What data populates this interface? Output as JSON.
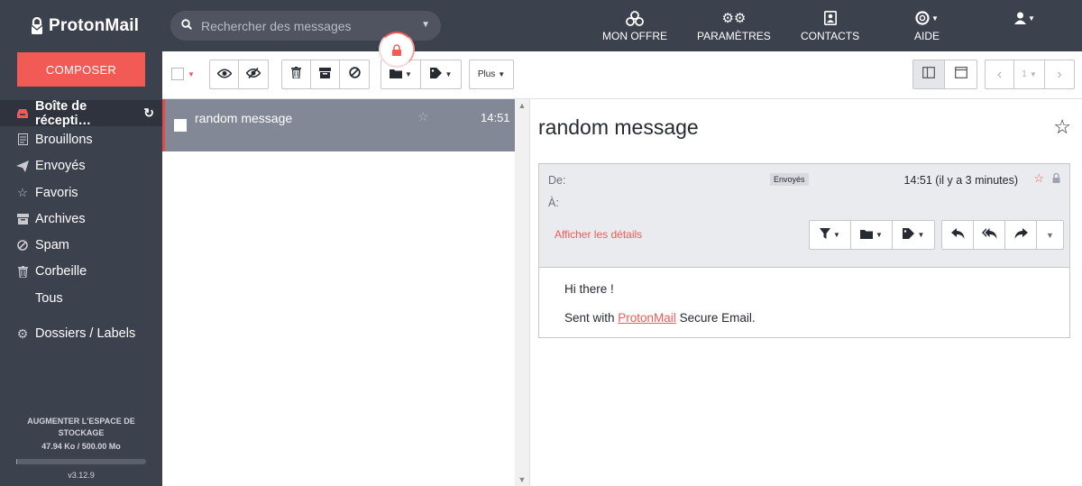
{
  "brand": {
    "name": "ProtonMail"
  },
  "sidebar": {
    "compose_label": "COMPOSER",
    "items": [
      {
        "label": "Boîte de récepti…",
        "icon": "inbox-icon"
      },
      {
        "label": "Brouillons",
        "icon": "file-icon"
      },
      {
        "label": "Envoyés",
        "icon": "paper-plane-icon"
      },
      {
        "label": "Favoris",
        "icon": "star-icon"
      },
      {
        "label": "Archives",
        "icon": "archive-icon"
      },
      {
        "label": "Spam",
        "icon": "ban-icon"
      },
      {
        "label": "Corbeille",
        "icon": "trash-icon"
      },
      {
        "label": "Tous",
        "icon": ""
      },
      {
        "label": "Dossiers / Labels",
        "icon": "gear-icon"
      }
    ],
    "storage_title": "AUGMENTER L'ESPACE DE STOCKAGE",
    "storage_value": "47.94 Ko / 500.00 Mo",
    "storage_used_fraction": 0.0001,
    "version": "v3.12.9"
  },
  "topbar": {
    "search_placeholder": "Rechercher des messages",
    "links": {
      "offer": "MON OFFRE",
      "settings": "PARAMÈTRES",
      "contacts": "CONTACTS",
      "help": "AIDE"
    }
  },
  "toolbar": {
    "more_label": "Plus",
    "page_number": "1"
  },
  "list": {
    "messages": [
      {
        "subject": "random message",
        "time": "14:51"
      }
    ]
  },
  "reader": {
    "title": "random message",
    "from_label": "De:",
    "to_label": "À:",
    "badge": "Envoyés",
    "timestamp": "14:51 (il y a 3 minutes)",
    "details_link": "Afficher les détails",
    "body_line1": "Hi there !",
    "body_prefix": "Sent with ",
    "body_link": "ProtonMail",
    "body_suffix": " Secure Email."
  },
  "colors": {
    "sidebar_bg": "#3c414e",
    "accent": "#f25a55",
    "selected_row": "#828895",
    "header_bg": "#e9ebef"
  }
}
